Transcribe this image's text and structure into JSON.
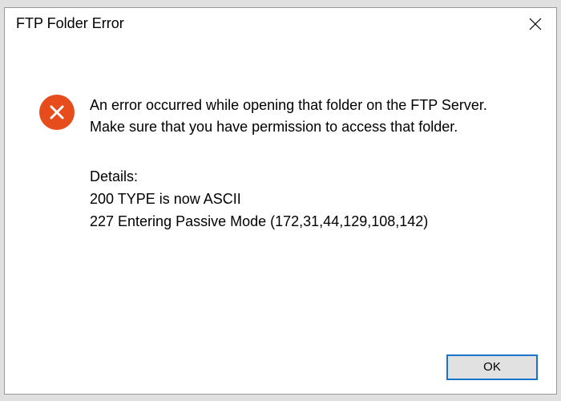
{
  "dialog": {
    "title": "FTP Folder Error",
    "message": "An error occurred while opening that folder on the FTP Server. Make sure that you have permission to access that folder.",
    "details_label": "Details:",
    "details_lines": [
      "200 TYPE is now ASCII",
      "227 Entering Passive Mode (172,31,44,129,108,142)"
    ],
    "ok_label": "OK"
  }
}
